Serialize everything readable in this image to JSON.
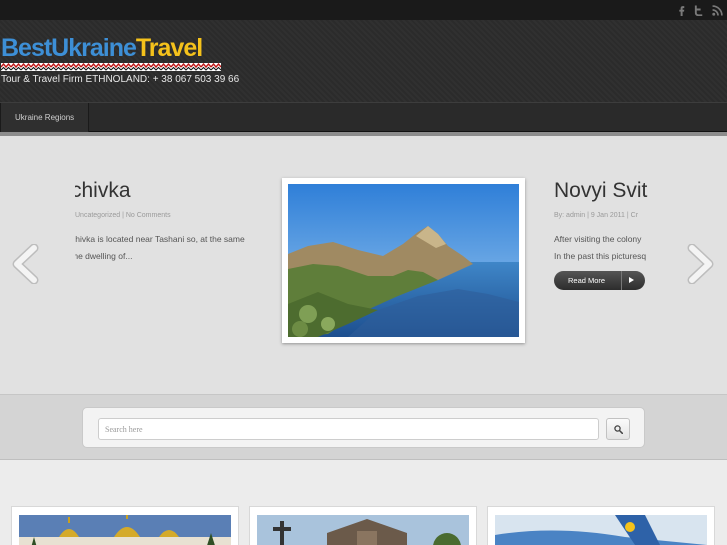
{
  "site": {
    "logo_part1": "BestUkraine",
    "logo_part2": "Travel",
    "tagline": "Tour & Travel Firm ETHNOLAND: + 38 067 503 39 66"
  },
  "social": [
    {
      "icon": "facebook-icon"
    },
    {
      "icon": "twitter-icon"
    },
    {
      "icon": "rss-icon"
    }
  ],
  "nav": {
    "items": [
      {
        "label": "Ukraine Regions"
      }
    ]
  },
  "slider": {
    "left_post": {
      "title": "chivka",
      "meta": "Uncategorized | No Comments",
      "excerpt_line1": "chivka is located near Tashani so, at the same",
      "excerpt_line2": "the dwelling of..."
    },
    "right_post": {
      "title": "Novyi Svit",
      "meta": "By: admin | 9 Jan 2011 | Cr",
      "excerpt_line1": "After visiting the colony",
      "excerpt_line2": "In the past this picturesq"
    },
    "read_more_label": "Read More"
  },
  "search": {
    "placeholder": "Search here"
  },
  "colors": {
    "logo_blue": "#3d8fd6",
    "logo_yellow": "#f5c21b",
    "header_bg": "#2b2b2b",
    "slider_bg": "#e1e1e1"
  }
}
